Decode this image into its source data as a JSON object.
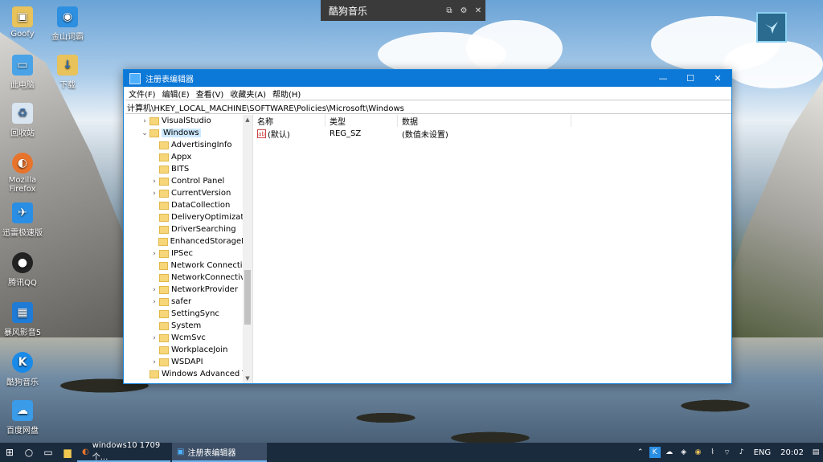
{
  "desktop": {
    "icons": [
      {
        "label": "Goofy",
        "icon": "user-folder-icon"
      },
      {
        "label": "金山词霸",
        "icon": "kingsoft-dictionary-icon"
      },
      {
        "label": "此电脑",
        "icon": "this-pc-icon"
      },
      {
        "label": "下载",
        "icon": "downloads-folder-icon"
      },
      {
        "label": "回收站",
        "icon": "recycle-bin-icon"
      },
      {
        "label": "Mozilla Firefox",
        "icon": "firefox-icon"
      },
      {
        "label": "迅雷极速版",
        "icon": "xunlei-icon"
      },
      {
        "label": "腾讯QQ",
        "icon": "qq-icon"
      },
      {
        "label": "暴风影音5",
        "icon": "baofeng-icon"
      },
      {
        "label": "酷狗音乐",
        "icon": "kugou-icon"
      },
      {
        "label": "百度网盘",
        "icon": "baidu-netdisk-icon"
      }
    ]
  },
  "music_bar": {
    "title": "酷狗音乐",
    "controls": [
      "restore-icon",
      "settings-icon",
      "close-icon"
    ]
  },
  "window": {
    "title": "注册表编辑器",
    "controls": {
      "minimize": "—",
      "maximize": "☐",
      "close": "✕"
    },
    "menu": [
      "文件(F)",
      "编辑(E)",
      "查看(V)",
      "收藏夹(A)",
      "帮助(H)"
    ],
    "address": "计算机\\HKEY_LOCAL_MACHINE\\SOFTWARE\\Policies\\Microsoft\\Windows",
    "tree": [
      {
        "label": "VisualStudio",
        "indent": 1,
        "chevron": "›",
        "selected": false
      },
      {
        "label": "Windows",
        "indent": 1,
        "chevron": "⌄",
        "selected": true
      },
      {
        "label": "AdvertisingInfo",
        "indent": 2,
        "chevron": "",
        "selected": false
      },
      {
        "label": "Appx",
        "indent": 2,
        "chevron": "",
        "selected": false
      },
      {
        "label": "BITS",
        "indent": 2,
        "chevron": "",
        "selected": false
      },
      {
        "label": "Control Panel",
        "indent": 2,
        "chevron": "›",
        "selected": false
      },
      {
        "label": "CurrentVersion",
        "indent": 2,
        "chevron": "›",
        "selected": false
      },
      {
        "label": "DataCollection",
        "indent": 2,
        "chevron": "",
        "selected": false
      },
      {
        "label": "DeliveryOptimizatio",
        "indent": 2,
        "chevron": "",
        "selected": false
      },
      {
        "label": "DriverSearching",
        "indent": 2,
        "chevron": "",
        "selected": false
      },
      {
        "label": "EnhancedStorageDe",
        "indent": 2,
        "chevron": "",
        "selected": false
      },
      {
        "label": "IPSec",
        "indent": 2,
        "chevron": "›",
        "selected": false
      },
      {
        "label": "Network Connection",
        "indent": 2,
        "chevron": "",
        "selected": false
      },
      {
        "label": "NetworkConnectivit",
        "indent": 2,
        "chevron": "",
        "selected": false
      },
      {
        "label": "NetworkProvider",
        "indent": 2,
        "chevron": "›",
        "selected": false
      },
      {
        "label": "safer",
        "indent": 2,
        "chevron": "›",
        "selected": false
      },
      {
        "label": "SettingSync",
        "indent": 2,
        "chevron": "",
        "selected": false
      },
      {
        "label": "System",
        "indent": 2,
        "chevron": "",
        "selected": false
      },
      {
        "label": "WcmSvc",
        "indent": 2,
        "chevron": "›",
        "selected": false
      },
      {
        "label": "WorkplaceJoin",
        "indent": 2,
        "chevron": "",
        "selected": false
      },
      {
        "label": "WSDAPI",
        "indent": 2,
        "chevron": "›",
        "selected": false
      },
      {
        "label": "Windows Advanced Th",
        "indent": 1,
        "chevron": "",
        "selected": false
      }
    ],
    "columns": [
      "名称",
      "类型",
      "数据"
    ],
    "rows": [
      {
        "name": "(默认)",
        "type": "REG_SZ",
        "data": "(数值未设置)"
      }
    ]
  },
  "taskbar": {
    "tasks": [
      {
        "label": "windows10 1709 个...",
        "icon": "firefox-icon",
        "active": false
      },
      {
        "label": "注册表编辑器",
        "icon": "regedit-icon",
        "active": true
      }
    ],
    "language": "ENG",
    "time": "20:02"
  }
}
